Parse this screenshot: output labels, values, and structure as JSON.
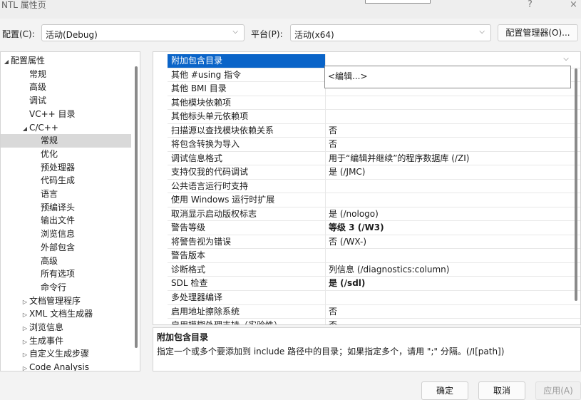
{
  "window": {
    "title": "NTL 属性页",
    "help_glyph": "?",
    "close_glyph": "×"
  },
  "config": {
    "configuration_label": "配置(C):",
    "configuration_value": "活动(Debug)",
    "platform_label": "平台(P):",
    "platform_value": "活动(x64)",
    "chevron": "⌵",
    "manager_button": "配置管理器(O)..."
  },
  "tree": {
    "expanded_arrow": "◢",
    "collapsed_arrow": "▷",
    "items": [
      {
        "label": "配置属性",
        "arrow": "expanded",
        "indent": 0
      },
      {
        "label": "常规",
        "arrow": "",
        "indent": 1
      },
      {
        "label": "高级",
        "arrow": "",
        "indent": 1
      },
      {
        "label": "调试",
        "arrow": "",
        "indent": 1
      },
      {
        "label": "VC++ 目录",
        "arrow": "",
        "indent": 1
      },
      {
        "label": "C/C++",
        "arrow": "expanded",
        "indent": 1
      },
      {
        "label": "常规",
        "arrow": "",
        "indent": 2,
        "selected": true
      },
      {
        "label": "优化",
        "arrow": "",
        "indent": 2
      },
      {
        "label": "预处理器",
        "arrow": "",
        "indent": 2
      },
      {
        "label": "代码生成",
        "arrow": "",
        "indent": 2
      },
      {
        "label": "语言",
        "arrow": "",
        "indent": 2
      },
      {
        "label": "预编译头",
        "arrow": "",
        "indent": 2
      },
      {
        "label": "输出文件",
        "arrow": "",
        "indent": 2
      },
      {
        "label": "浏览信息",
        "arrow": "",
        "indent": 2
      },
      {
        "label": "外部包含",
        "arrow": "",
        "indent": 2
      },
      {
        "label": "高级",
        "arrow": "",
        "indent": 2
      },
      {
        "label": "所有选项",
        "arrow": "",
        "indent": 2
      },
      {
        "label": "命令行",
        "arrow": "",
        "indent": 2
      },
      {
        "label": "文档管理程序",
        "arrow": "collapsed",
        "indent": 1
      },
      {
        "label": "XML 文档生成器",
        "arrow": "collapsed",
        "indent": 1
      },
      {
        "label": "浏览信息",
        "arrow": "collapsed",
        "indent": 1
      },
      {
        "label": "生成事件",
        "arrow": "collapsed",
        "indent": 1
      },
      {
        "label": "自定义生成步骤",
        "arrow": "collapsed",
        "indent": 1
      },
      {
        "label": "Code Analysis",
        "arrow": "collapsed",
        "indent": 1
      }
    ]
  },
  "grid": {
    "rows": [
      {
        "name": "附加包含目录",
        "value": "",
        "selected": true
      },
      {
        "name": "其他 #using 指令",
        "value": ""
      },
      {
        "name": "其他 BMI 目录",
        "value": ""
      },
      {
        "name": "其他模块依赖项",
        "value": ""
      },
      {
        "name": "其他标头单元依赖项",
        "value": ""
      },
      {
        "name": "扫描源以查找模块依赖关系",
        "value": "否"
      },
      {
        "name": "将包含转换为导入",
        "value": "否"
      },
      {
        "name": "调试信息格式",
        "value": "用于“编辑并继续”的程序数据库 (/ZI)"
      },
      {
        "name": "支持仅我的代码调试",
        "value": "是 (/JMC)"
      },
      {
        "name": "公共语言运行时支持",
        "value": ""
      },
      {
        "name": "使用 Windows 运行时扩展",
        "value": ""
      },
      {
        "name": "取消显示启动版权标志",
        "value": "是 (/nologo)"
      },
      {
        "name": "警告等级",
        "value": "等级 3 (/W3)",
        "bold": true
      },
      {
        "name": "将警告视为错误",
        "value": "否 (/WX-)"
      },
      {
        "name": "警告版本",
        "value": ""
      },
      {
        "name": "诊断格式",
        "value": "列信息 (/diagnostics:column)"
      },
      {
        "name": "SDL 检查",
        "value": "是 (/sdl)",
        "bold": true
      },
      {
        "name": "多处理器编译",
        "value": ""
      },
      {
        "name": "启用地址擦除系统",
        "value": "否"
      },
      {
        "name": "启用模糊处理支持（实验性）",
        "value": "否"
      }
    ],
    "dropdown_glyph": "⌵",
    "popup_item": "<编辑...>"
  },
  "description": {
    "title": "附加包含目录",
    "body": "指定一个或多个要添加到 include 路径中的目录；如果指定多个，请用 \";\" 分隔。(/I[path])"
  },
  "buttons": {
    "ok": "确定",
    "cancel": "取消",
    "apply": "应用(A)"
  },
  "colors": {
    "selection_blue": "#0a64c8",
    "tree_selection": "#d9d9d9"
  }
}
